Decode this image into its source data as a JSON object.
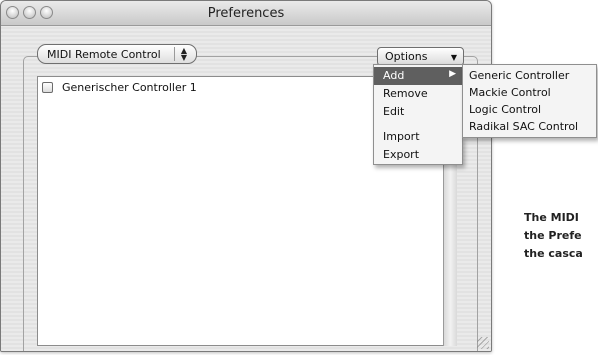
{
  "window": {
    "title": "Preferences"
  },
  "toolbar": {
    "remote_popup_label": "MIDI Remote Control",
    "options_label": "Options"
  },
  "list": {
    "items": [
      {
        "label": "Generischer Controller 1",
        "checked": false
      }
    ]
  },
  "options_menu": {
    "items": [
      {
        "label": "Add",
        "selected": true,
        "has_submenu": true
      },
      {
        "label": "Remove"
      },
      {
        "label": "Edit"
      },
      {
        "label": "Import"
      },
      {
        "label": "Export"
      }
    ]
  },
  "add_submenu": {
    "items": [
      {
        "label": "Generic Controller"
      },
      {
        "label": "Mackie Control"
      },
      {
        "label": "Logic Control"
      },
      {
        "label": "Radikal SAC Control"
      }
    ]
  },
  "caption": {
    "lines": [
      "The MIDI",
      "the Prefe",
      "the casca"
    ]
  },
  "icons": {
    "close": "close-button-icon",
    "minimize": "minimize-button-icon",
    "zoom": "zoom-button-icon",
    "popup_arrows": "up-down-arrows-icon",
    "dropdown": "dropdown-arrow-icon",
    "submenu": "submenu-arrow-icon",
    "resize": "resize-grip-icon"
  }
}
